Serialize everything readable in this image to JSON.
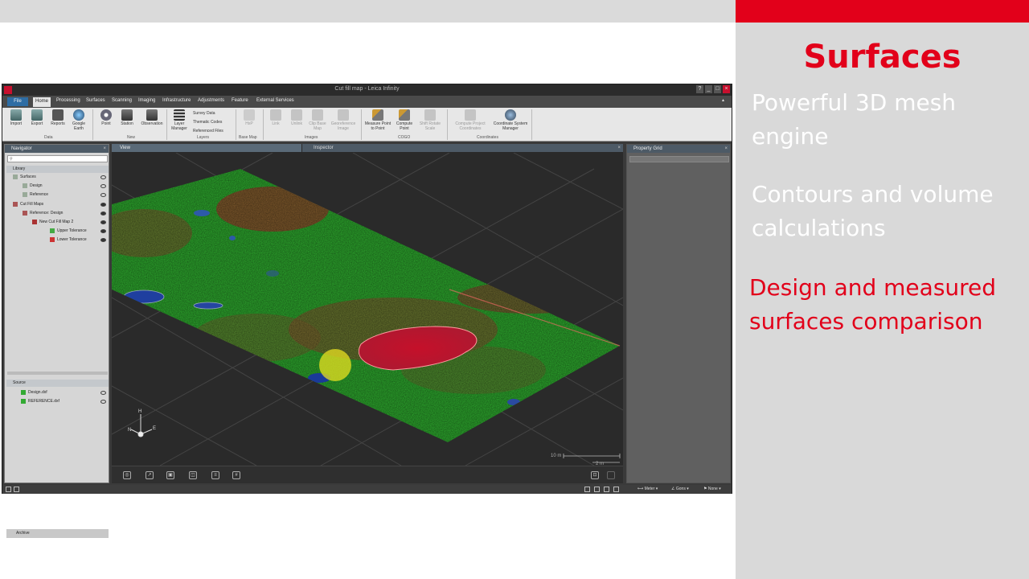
{
  "slide": {
    "title": "Surfaces",
    "bullets": [
      {
        "text": "Powerful 3D mesh engine",
        "color": "#ffffff"
      },
      {
        "text": "Contours and volume calculations",
        "color": "#ffffff"
      },
      {
        "text": "Design and measured surfaces comparison",
        "color": "#e2001a"
      }
    ],
    "accent_color": "#e2001a"
  },
  "app": {
    "title": "Cut fill map - Leica Infinity",
    "menu": [
      "File",
      "Home",
      "Processing",
      "Surfaces",
      "Scanning",
      "Imaging",
      "Infrastructure",
      "Adjustments",
      "Feature",
      "External Services"
    ],
    "active_menu": "Home",
    "ribbon": {
      "data": {
        "label": "Data",
        "buttons": [
          "Import",
          "Export",
          "Reports",
          "Google Earth"
        ]
      },
      "new": {
        "label": "New",
        "buttons": [
          "Point",
          "Station",
          "Observation"
        ]
      },
      "layers": {
        "label": "Layers",
        "button": "Layer Manager",
        "items": [
          "Survey Data",
          "Thematic Codes",
          "Referenced Files"
        ]
      },
      "base_map": {
        "label": "Base Map",
        "button": "HxP"
      },
      "images": {
        "label": "Images",
        "buttons": [
          "Link",
          "Unlink",
          "Clip Base Map",
          "Georeference Image"
        ]
      },
      "cogo": {
        "label": "COGO",
        "buttons": [
          "Measure Point to Point",
          "Compute Point",
          "Shift Rotate Scale"
        ]
      },
      "coordinates": {
        "label": "Coordinates",
        "buttons": [
          "Compute Project Coordinates",
          "Coordinate System Manager"
        ]
      }
    },
    "navigator": {
      "title": "Navigator",
      "library": "Library",
      "tree": [
        {
          "label": "Surfaces",
          "eye": "off"
        },
        {
          "label": "Design",
          "eye": "off"
        },
        {
          "label": "Reference",
          "eye": "off"
        },
        {
          "label": "Cut Fill Maps",
          "eye": "on"
        },
        {
          "label": "Reference: Design",
          "eye": "on"
        },
        {
          "label": "New Cut Fill Map 2",
          "eye": "on"
        },
        {
          "label": "Upper Tolerance",
          "eye": "on"
        },
        {
          "label": "Lower Tolerance",
          "eye": "on"
        }
      ],
      "source": "Source",
      "source_items": [
        {
          "label": "Design.dxf",
          "eye": "off"
        },
        {
          "label": "REFERENCE.dxf",
          "eye": "off"
        }
      ],
      "archive": "Archive"
    },
    "view_tab": "View",
    "inspector_tab": "Inspector",
    "property_grid": "Property Grid",
    "scale_labels": [
      "10 m",
      "2 m"
    ],
    "axis": {
      "h": "H",
      "n": "N",
      "e": "E"
    },
    "statusbar": {
      "units": "Meter",
      "angle": "Gons",
      "extra": "None"
    }
  }
}
